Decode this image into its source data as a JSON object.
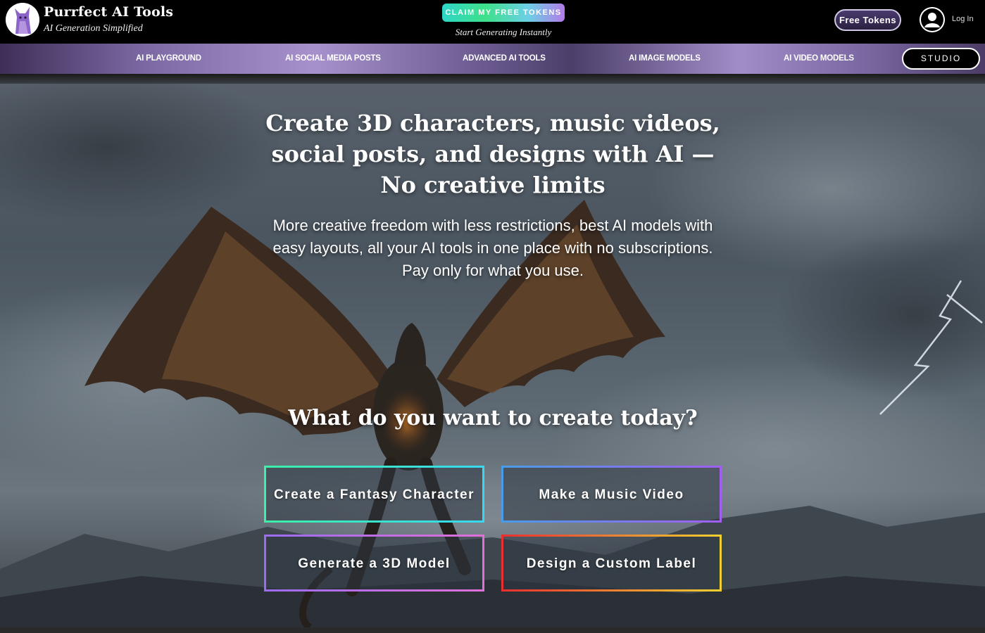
{
  "brand": {
    "title": "Purrfect AI Tools",
    "subtitle": "AI Generation Simplified",
    "logo_icon": "purple-cat-logo-icon"
  },
  "header": {
    "claim_label": "CLAIM MY FREE TOKENS",
    "claim_sub": "Start Generating Instantly",
    "free_tokens_label": "Free Tokens",
    "user_icon": "user-avatar-icon",
    "login_label": "Log In"
  },
  "nav": {
    "items": [
      {
        "label": "AI PLAYGROUND"
      },
      {
        "label": "AI SOCIAL MEDIA POSTS"
      },
      {
        "label": "ADVANCED AI TOOLS"
      },
      {
        "label": "AI IMAGE MODELS"
      },
      {
        "label": "AI VIDEO MODELS"
      }
    ],
    "studio_label": "STUDIO"
  },
  "hero": {
    "headline": "Create 3D characters, music videos, social posts, and designs with AI — No creative limits",
    "subtext": "More creative freedom with less restrictions, best AI models with easy layouts, all your AI tools in one place with no subscriptions. Pay only for what you use.",
    "question": "What do you want to create today?",
    "ctas": [
      {
        "label": "Create a Fantasy Character"
      },
      {
        "label": "Make a Music Video"
      },
      {
        "label": "Generate a 3D Model"
      },
      {
        "label": "Design a Custom Label"
      }
    ],
    "background_image": "dragon-storm-background"
  },
  "colors": {
    "nav_purple": "#a791cc",
    "claim_teal": "#2fd6c8",
    "header_bg": "#000000"
  }
}
